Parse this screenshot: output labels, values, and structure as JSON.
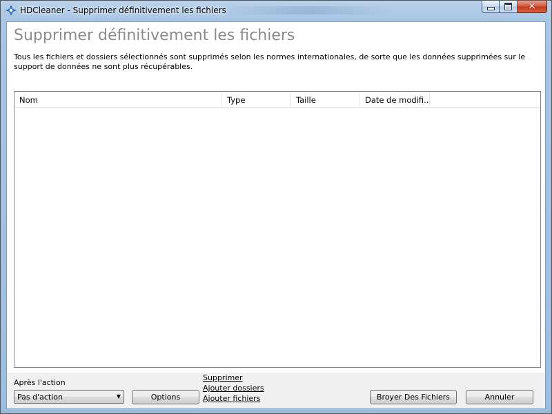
{
  "window": {
    "title": "HDCleaner - Supprimer définitivement les fichiers",
    "icon": "hdcleaner-app-icon",
    "controls": {
      "minimize": "minimize-icon",
      "maximize": "maximize-icon",
      "close": "close-icon"
    }
  },
  "page": {
    "heading": "Supprimer définitivement les fichiers",
    "description": "Tous les fichiers et dossiers sélectionnés sont supprimés selon les normes internationales, de sorte que les données supprimées sur le support de données ne sont plus récupérables."
  },
  "file_list": {
    "columns": [
      "Nom",
      "Type",
      "Taille",
      "Date de modifi..."
    ],
    "rows": []
  },
  "footer": {
    "after_action_label": "Après l'action",
    "after_action_value": "Pas d'action",
    "options_button": "Options",
    "links": [
      "Supprimer",
      "Ajouter dossiers",
      "Ajouter fichiers"
    ],
    "shred_button": "Broyer Des Fichiers",
    "cancel_button": "Annuler"
  },
  "colors": {
    "frame": "#a8c5e3",
    "heading": "#8a8a8a",
    "close_button": "#c23a1d"
  }
}
